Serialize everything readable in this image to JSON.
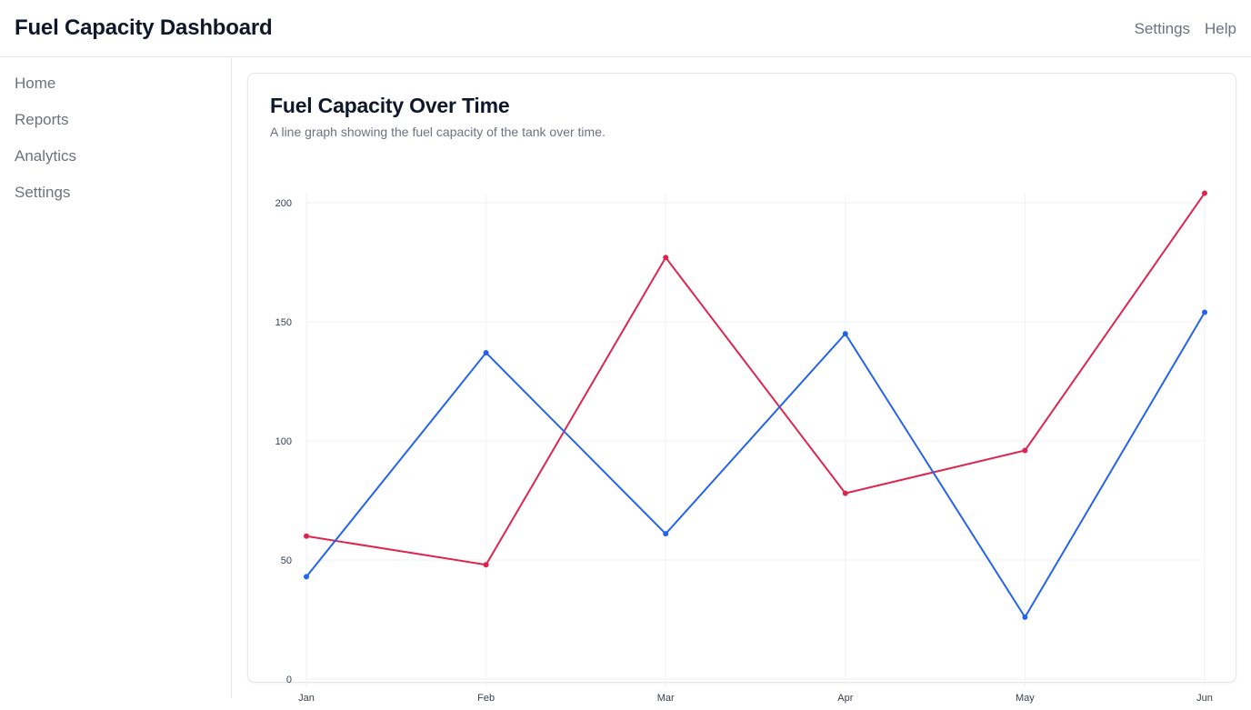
{
  "header": {
    "title": "Fuel Capacity Dashboard",
    "nav": [
      {
        "label": "Settings"
      },
      {
        "label": "Help"
      }
    ]
  },
  "sidebar": {
    "items": [
      {
        "label": "Home"
      },
      {
        "label": "Reports"
      },
      {
        "label": "Analytics"
      },
      {
        "label": "Settings"
      }
    ]
  },
  "card": {
    "title": "Fuel Capacity Over Time",
    "subtitle": "A line graph showing the fuel capacity of the tank over time."
  },
  "chart_data": {
    "type": "line",
    "categories": [
      "Jan",
      "Feb",
      "Mar",
      "Apr",
      "May",
      "Jun"
    ],
    "ylim": [
      0,
      200
    ],
    "yticks": [
      0,
      50,
      100,
      150,
      200
    ],
    "grid": true,
    "legend": "none",
    "series": [
      {
        "color": "#dc2650",
        "values": [
          60,
          48,
          177,
          78,
          96,
          204
        ]
      },
      {
        "color": "#2563eb",
        "values": [
          43,
          137,
          61,
          145,
          26,
          154
        ]
      }
    ]
  }
}
